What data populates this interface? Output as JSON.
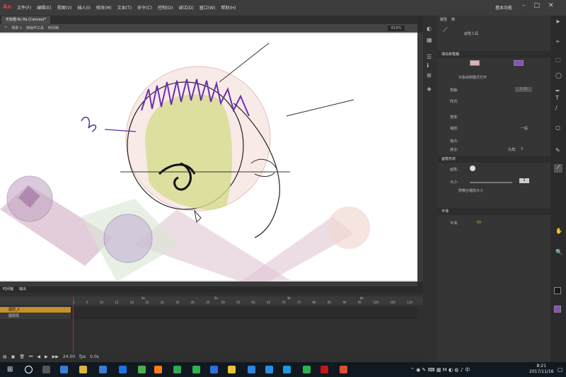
{
  "app": {
    "logo": "An",
    "workspace": "基本功能"
  },
  "menu": [
    "文件(F)",
    "编辑(E)",
    "视图(V)",
    "插入(I)",
    "修改(M)",
    "文本(T)",
    "命令(C)",
    "控制(O)",
    "调试(D)",
    "窗口(W)",
    "帮助(H)"
  ],
  "document": {
    "tab": "无标题-6c.fla (Canvas)*"
  },
  "editbar": {
    "scene": "场景 1",
    "crumbs": [
      "帧操作工具",
      "时间帧"
    ],
    "zoom": "819%"
  },
  "timeline": {
    "tabs": [
      "时间轴",
      "输出"
    ],
    "ruler_seconds": [
      "1s",
      "2s",
      "3s",
      "4s"
    ],
    "ruler_frames": [
      "1",
      "5",
      "10",
      "15",
      "20",
      "25",
      "30",
      "35",
      "40",
      "45",
      "50",
      "55",
      "60",
      "65",
      "70",
      "75",
      "80",
      "85",
      "90",
      "95",
      "100",
      "105",
      "110"
    ],
    "layers": [
      "图层_2",
      "图层层"
    ],
    "footer": {
      "fps": "24.00",
      "fps_label": "fps",
      "time": "0.0s"
    }
  },
  "properties": {
    "tabs": [
      "属性",
      "库"
    ],
    "tool_name": "画笔工具",
    "fill_stroke": {
      "title": "填充和笔触",
      "object_draw": "对象绘制模式打开",
      "stroke_label": "笔触:",
      "stroke_value": "1.00",
      "style_label": "样式:",
      "width_label": "宽度:",
      "scale_label": "缩放:",
      "scale_value": "一般",
      "cap_label": "端点:",
      "join_label": "接合:",
      "miter_label": "尖角:",
      "miter_value": "3"
    },
    "brush_shape": {
      "title": "画笔形状",
      "brush_label": "画笔:",
      "size_label": "大小:",
      "size_value": "2",
      "scale_check": "随舞台缩放大小"
    },
    "smoothing": {
      "title": "平滑",
      "label": "平滑:",
      "value": "65"
    }
  },
  "colors": {
    "fill": "#8a4cc2",
    "accent": "#c4902a",
    "playhead": "#d02020"
  },
  "clock": {
    "time": "8:21",
    "date": "2017/11/16"
  }
}
